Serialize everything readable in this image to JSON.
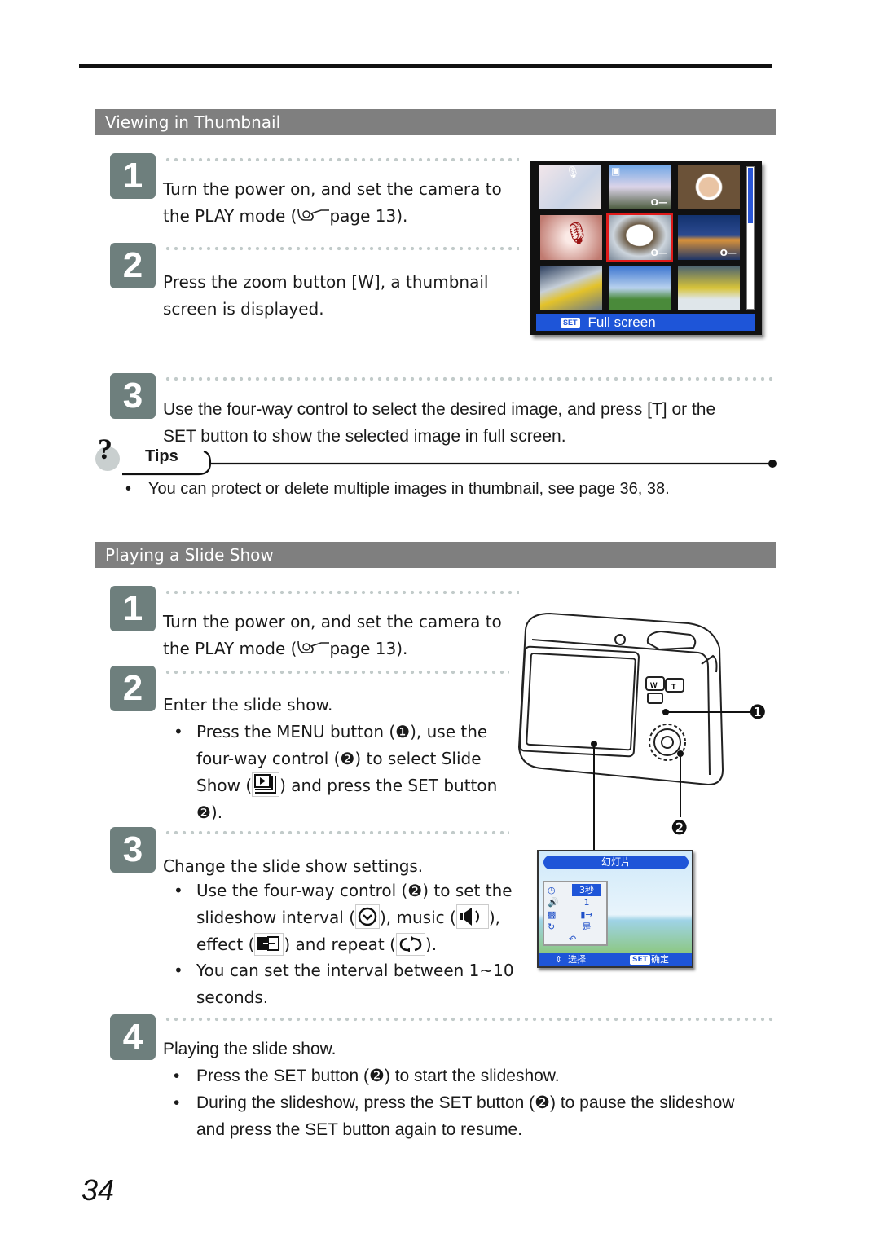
{
  "page_number": "34",
  "sections": {
    "thumbnail": {
      "title": "Viewing in Thumbnail",
      "steps": [
        {
          "num": "1",
          "line1": "Turn the power on, and set the camera to",
          "line2_pre": "the PLAY mode (",
          "line2_post": "page 13)."
        },
        {
          "num": "2",
          "line1": "Press the zoom button [W], a thumbnail",
          "line2": "screen is displayed."
        },
        {
          "num": "3",
          "line1": "Use the four-way control to select the desired image, and press [T] or the",
          "line2": "SET button to show the selected image in full screen."
        }
      ],
      "screen": {
        "footer_chip": "SET",
        "footer_label": "Full screen",
        "selected_index": 4,
        "thumbnails": [
          {
            "name": "baby-photo",
            "badge": "voice-memo-icon"
          },
          {
            "name": "cherry-tree-photo",
            "badge": "video-icon",
            "protected": true
          },
          {
            "name": "porthole-kids-photo"
          },
          {
            "name": "voice-recording",
            "badge": "microphone-icon"
          },
          {
            "name": "coffee-cup-photo",
            "protected": true
          },
          {
            "name": "city-night-photo",
            "protected": true
          },
          {
            "name": "race-car-photo"
          },
          {
            "name": "lighthouse-photo"
          },
          {
            "name": "water-ride-photo"
          }
        ],
        "accent": "#1e55d8",
        "selection_color": "#e01a1a"
      },
      "tips": {
        "label": "Tips",
        "items": [
          "You can protect or delete multiple images in thumbnail, see page 36, 38."
        ]
      }
    },
    "slideshow": {
      "title": "Playing a Slide Show",
      "step1": {
        "num": "1",
        "line1": "Turn the power on, and set the camera to",
        "line2_pre": "the PLAY mode (",
        "line2_post": "page 13)."
      },
      "step2": {
        "num": "2",
        "heading": "Enter the slide show.",
        "bullet": {
          "l1": "Press the MENU button (❶), use the",
          "l2": "four-way control (❷) to select Slide",
          "l3_pre": "Show (",
          "l3_post": ") and press the SET button",
          "l4": "❷)."
        }
      },
      "step3": {
        "num": "3",
        "heading": "Change the slide show settings.",
        "bullet1": {
          "l1": "Use the four-way control (❷) to set the",
          "l2_a": "slideshow interval (",
          "l2_b": "), music (",
          "l2_c": "),",
          "l3_a": "effect (",
          "l3_b": ") and repeat (",
          "l3_c": ")."
        },
        "bullet2": {
          "l1": "You can set the interval between 1~10",
          "l2": "seconds."
        }
      },
      "step4": {
        "num": "4",
        "heading": "Playing the slide show.",
        "bullets": [
          {
            "l1": "Press the SET button (❷) to start the slideshow."
          },
          {
            "l1": "During the slideshow, press the SET button (❷) to pause the slideshow",
            "l2": "and press the SET button again to resume."
          }
        ]
      },
      "camera_callouts": [
        "❶",
        "❷"
      ],
      "camera_buttons": {
        "w": "W",
        "t": "T"
      },
      "menu_screen": {
        "title": "幻灯片",
        "rows": [
          {
            "icon": "clock-icon",
            "value": "3秒",
            "selected": true
          },
          {
            "icon": "speaker-icon",
            "value": "1"
          },
          {
            "icon": "effect-icon",
            "value": "▮→"
          },
          {
            "icon": "repeat-icon",
            "value": "是"
          },
          {
            "icon": "return-icon",
            "value": ""
          }
        ],
        "footer_left": "选择",
        "footer_chip": "SET",
        "footer_right": "确定"
      }
    }
  }
}
